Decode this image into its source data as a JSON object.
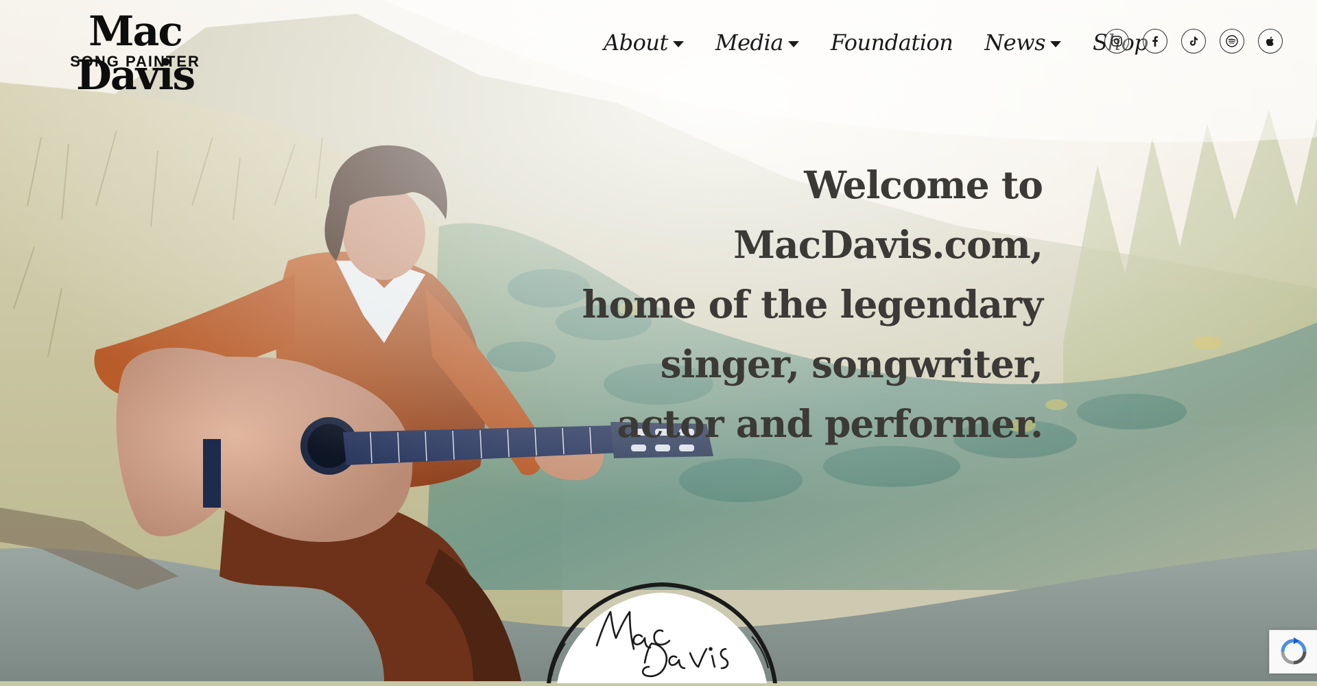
{
  "brand": {
    "name": "Mac Davis",
    "tagline": "SONG PAINTER"
  },
  "nav": [
    {
      "label": "About",
      "has_dropdown": true
    },
    {
      "label": "Media",
      "has_dropdown": true
    },
    {
      "label": "Foundation",
      "has_dropdown": false
    },
    {
      "label": "News",
      "has_dropdown": true
    },
    {
      "label": "Shop",
      "has_dropdown": false
    }
  ],
  "socials": [
    {
      "icon": "instagram-icon"
    },
    {
      "icon": "facebook-icon"
    },
    {
      "icon": "tiktok-icon"
    },
    {
      "icon": "spotify-icon"
    },
    {
      "icon": "apple-icon"
    }
  ],
  "hero": {
    "lines": [
      "Welcome to MacDavis.com,",
      "home of the legendary",
      "singer, songwriter,",
      "actor and performer."
    ]
  },
  "signature": {
    "text": "Mac Davis"
  },
  "colors": {
    "text_dark": "#3c3a36",
    "nav_text": "#1a1a1a",
    "badge_bg": "#ffffff"
  }
}
